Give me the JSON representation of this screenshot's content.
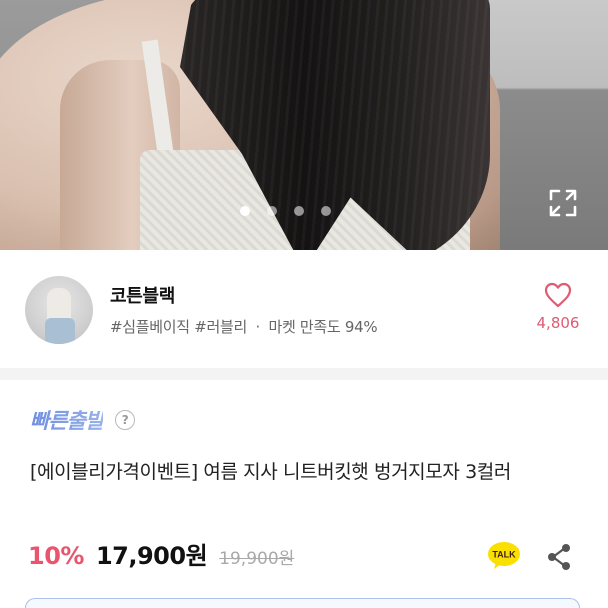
{
  "hero": {
    "image_alt": "product photo",
    "carousel": {
      "total": 4,
      "active_index": 0
    },
    "expand_icon": "expand-icon"
  },
  "seller": {
    "name": "코튼블랙",
    "tags": [
      "#심플베이직",
      "#러블리"
    ],
    "separator": "·",
    "satisfaction": "마켓 만족도 94%",
    "likes": "4,806",
    "heart_icon": "heart-outline-icon"
  },
  "product": {
    "badge": "빠른출발",
    "help_icon": "?",
    "title": "[에이블리가격이벤트] 여름 지사 니트버킷햇 벙거지모자 3컬러",
    "discount": "10%",
    "price": "17,900원",
    "original_price": "19,900원",
    "talk_label": "TALK",
    "share_icon": "share-icon"
  },
  "colors": {
    "accent_pink": "#e9556f",
    "badge_blue": "#7d9ae0",
    "talk_yellow": "#f9e000"
  }
}
